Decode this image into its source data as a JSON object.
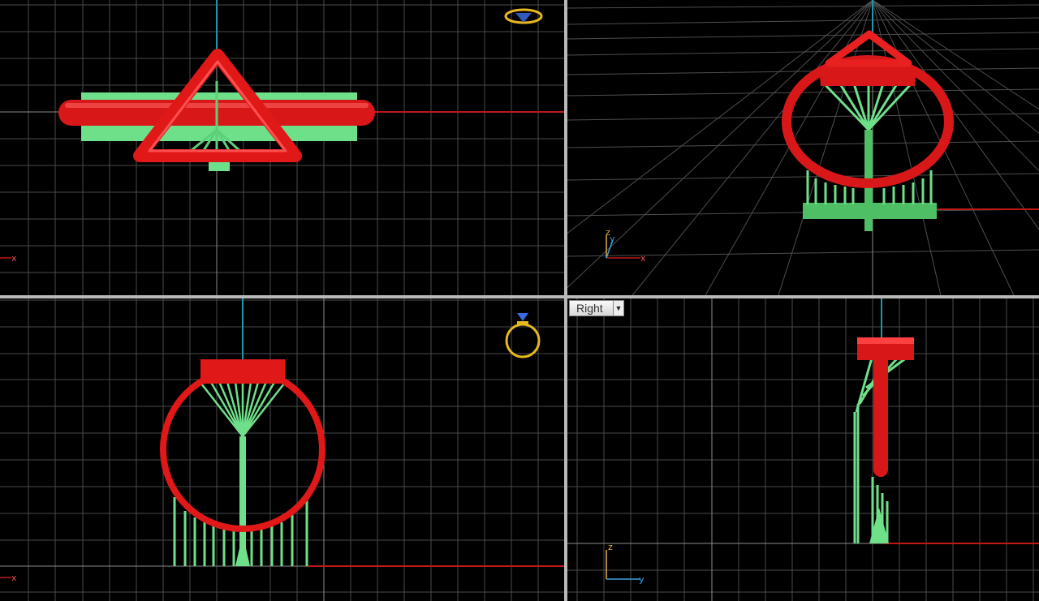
{
  "viewports": {
    "top": {
      "axis_x": "x"
    },
    "perspective": {
      "axis_x": "x",
      "axis_y": "y",
      "axis_z": "z"
    },
    "front": {
      "axis_x": "x"
    },
    "right": {
      "title": "Right",
      "axis_y": "y",
      "axis_z": "z"
    }
  },
  "colors": {
    "background": "#000000",
    "grid": "#5a5a5a",
    "x_axis": "#c01818",
    "y_axis": "#1a9aa8",
    "ring_red": "#e01818",
    "support_green": "#6fe08a",
    "gizmo_gold": "#e8b820"
  },
  "icons": {
    "top_gizmo": "ring-top-gizmo-icon",
    "front_gizmo": "ring-front-gizmo-icon",
    "dropdown": "triangle-down-icon"
  }
}
